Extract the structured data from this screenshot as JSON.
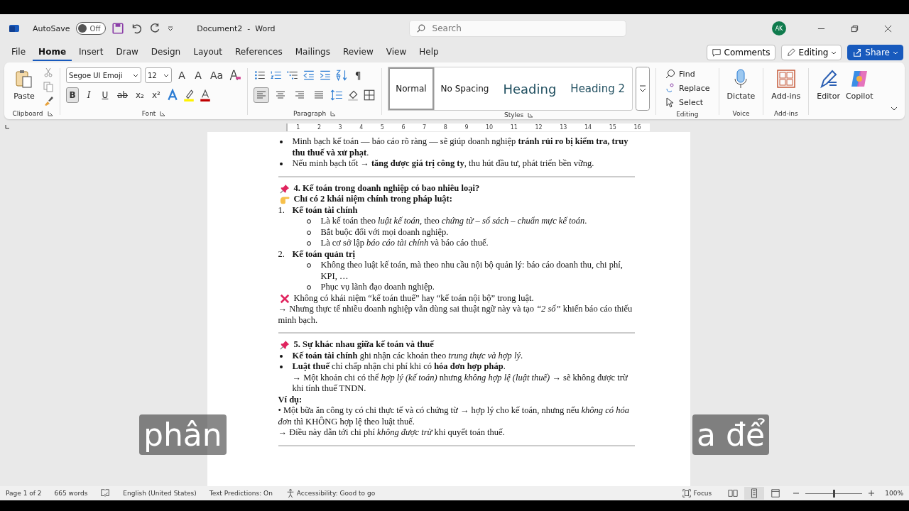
{
  "title_bar": {
    "autosave_label": "AutoSave",
    "autosave": {
      "label": "Off",
      "on": false
    },
    "document_title": "Document2  -  Word",
    "search": {
      "placeholder": "Search"
    },
    "avatar": "AK"
  },
  "menu_tabs": [
    {
      "label": "File",
      "selected": false
    },
    {
      "label": "Home",
      "selected": true
    },
    {
      "label": "Insert",
      "selected": false
    },
    {
      "label": "Draw",
      "selected": false
    },
    {
      "label": "Design",
      "selected": false
    },
    {
      "label": "Layout",
      "selected": false
    },
    {
      "label": "References",
      "selected": false
    },
    {
      "label": "Mailings",
      "selected": false
    },
    {
      "label": "Review",
      "selected": false
    },
    {
      "label": "View",
      "selected": false
    },
    {
      "label": "Help",
      "selected": false
    }
  ],
  "header_buttons": {
    "comments": "Comments",
    "editing": "Editing",
    "share": "Share"
  },
  "ribbon": {
    "clipboard": {
      "paste": "Paste",
      "label": "Clipboard"
    },
    "font": {
      "name": "Segoe UI Emoji",
      "size": "12",
      "size_buttons": [
        "A",
        "A",
        "Aa"
      ],
      "label": "Font",
      "format_buttons": [
        {
          "label": "B",
          "selected": true,
          "kind": "bold"
        },
        {
          "label": "I",
          "selected": false,
          "kind": "italic"
        },
        {
          "label": "U",
          "selected": false,
          "kind": "underline"
        },
        {
          "label": "ab",
          "selected": false,
          "kind": "strike"
        },
        {
          "label": "x₂",
          "selected": false,
          "kind": "plain"
        },
        {
          "label": "x²",
          "selected": false,
          "kind": "plain"
        }
      ]
    },
    "paragraph": {
      "label": "Paragraph",
      "pilcrow": "¶",
      "align_buttons": [
        {
          "kind": "left",
          "selected": true
        },
        {
          "kind": "center",
          "selected": false
        },
        {
          "kind": "right",
          "selected": false
        },
        {
          "kind": "justify",
          "selected": false
        }
      ]
    },
    "styles": {
      "label": "Styles",
      "items": [
        {
          "label": "Normal",
          "kind": "normal",
          "selected": true
        },
        {
          "label": "No Spacing",
          "kind": "normal",
          "selected": false
        },
        {
          "label": "Heading",
          "kind": "heading1",
          "selected": false
        },
        {
          "label": "Heading 2",
          "kind": "heading2",
          "selected": false
        }
      ]
    },
    "editing": {
      "label": "Editing",
      "items": [
        {
          "label": "Find",
          "kind": "find"
        },
        {
          "label": "Replace",
          "kind": "replace"
        },
        {
          "label": "Select",
          "kind": "select"
        }
      ]
    },
    "voice": {
      "label": "Voice",
      "dictate": "Dictate"
    },
    "addins": {
      "label": "Add-ins",
      "button": "Add-ins"
    },
    "tools": [
      {
        "label": "Editor",
        "kind": "editor"
      },
      {
        "label": "Copilot",
        "kind": "copilot"
      }
    ]
  },
  "ruler": [
    "1",
    "2",
    "3",
    "4",
    "5",
    "6",
    "7",
    "8",
    "9",
    "10",
    "11",
    "12",
    "13",
    "14",
    "15",
    "16"
  ],
  "document": [
    {
      "kind": "bullet",
      "text": "Minh bạch kế toán — báo cáo rõ ràng — sẽ giúp doanh nghiệp **tránh rủi ro bị kiểm tra, truy thu thuế và xử phạt**."
    },
    {
      "kind": "bullet",
      "text": "Nếu minh bạch tốt → **tăng được giá trị công ty**, thu hút đầu tư, phát triển bền vững."
    },
    {
      "kind": "rule"
    },
    {
      "kind": "pinheading",
      "text": "4. Kế toán trong doanh nghiệp có bao nhiêu loại?"
    },
    {
      "kind": "handheading",
      "text": "Chỉ có 2 khái niệm chính trong pháp luật:"
    },
    {
      "kind": "numbered",
      "number": "1.",
      "text": "Kế toán tài chính"
    },
    {
      "kind": "sub",
      "text": "Là kế toán theo *luật kế toán*, theo *chứng từ – sổ sách – chuẩn mực kế toán*."
    },
    {
      "kind": "sub",
      "text": "Bắt buộc đối với mọi doanh nghiệp."
    },
    {
      "kind": "sub",
      "text": "Là cơ sở lập *báo cáo tài chính* và báo cáo thuế."
    },
    {
      "kind": "numbered",
      "number": "2.",
      "text": "Kế toán quản trị"
    },
    {
      "kind": "sub",
      "text": "Không theo luật kế toán, mà theo nhu cầu nội bộ quản lý: báo cáo doanh thu, chi phí, KPI, …"
    },
    {
      "kind": "sub",
      "text": "Phục vụ lãnh đạo doanh nghiệp."
    },
    {
      "kind": "note",
      "text": "Không có khái niệm “kế toán thuế” hay “kế toán nội bộ” trong luật."
    },
    {
      "kind": "para",
      "text": "→ Nhưng thực tế nhiều doanh nghiệp vẫn dùng sai thuật ngữ này và tạo *“2 sổ”* khiến báo cáo thiếu minh bạch."
    },
    {
      "kind": "rule"
    },
    {
      "kind": "pinheading",
      "text": "5. Sự khác nhau giữa kế toán và thuế"
    },
    {
      "kind": "bullet",
      "text": "**Kế toán tài chính** ghi nhận các khoản theo *trung thực và hợp lý*."
    },
    {
      "kind": "bullet",
      "text": "**Luật thuế** chỉ chấp nhận chi phí khi có **hóa đơn hợp pháp**."
    },
    {
      "kind": "continuation",
      "text": "→ Một khoản chi có thể *hợp lý (kế toán)* nhưng *không hợp lệ (luật thuế)* → sẽ không được trừ khi tính thuế TNDN."
    },
    {
      "kind": "label",
      "text": "Ví dụ:"
    },
    {
      "kind": "para",
      "text": "• Một bữa ăn công ty có chi thực tế và có chứng từ → hợp lý cho kế toán, nhưng nếu *không có hóa đơn* thì KHÔNG hợp lệ theo luật thuế."
    },
    {
      "kind": "para",
      "text": " → Điều này dẫn tới chi phí *không được trừ* khi quyết toán thuế."
    },
    {
      "kind": "rule"
    }
  ],
  "subtitle": [
    "phân",
    "a để"
  ],
  "status_bar": {
    "page": "Page 1 of 2",
    "words": "665 words",
    "language": "English (United States)",
    "predictions": "Text Predictions: On",
    "accessibility": "Accessibility: Good to go",
    "focus": "Focus",
    "views": [
      {
        "kind": "read",
        "selected": false
      },
      {
        "kind": "print",
        "selected": true
      },
      {
        "kind": "web",
        "selected": false
      }
    ],
    "zoom": {
      "level": 0.5,
      "label": "100%"
    }
  }
}
